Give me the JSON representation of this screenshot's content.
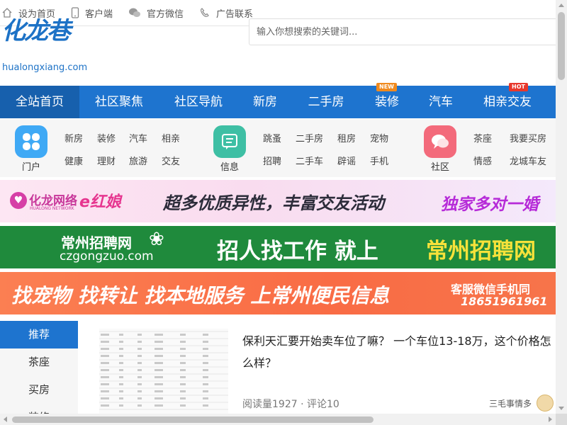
{
  "topbar": {
    "items": [
      {
        "label": "设为首页",
        "icon": "home-icon"
      },
      {
        "label": "客户端",
        "icon": "mobile-icon"
      },
      {
        "label": "官方微信",
        "icon": "wechat-icon"
      },
      {
        "label": "广告联系",
        "icon": "phone-icon"
      }
    ]
  },
  "header": {
    "logo_cn": "化龙巷",
    "logo_en": "hualongxiang.com",
    "search_placeholder": "输入你想搜索的关键词..."
  },
  "nav": {
    "items": [
      {
        "label": "全站首页"
      },
      {
        "label": "社区聚焦"
      },
      {
        "label": "社区导航"
      },
      {
        "label": "新房"
      },
      {
        "label": "二手房"
      },
      {
        "label": "装修",
        "badge": "NEW"
      },
      {
        "label": "汽车"
      },
      {
        "label": "相亲交友",
        "badge": "HOT"
      }
    ],
    "accent": "#1e74cf"
  },
  "categories": [
    {
      "label": "门户",
      "icon": "clover-icon",
      "color": "#3fa9f5",
      "links": [
        "新房",
        "装修",
        "汽车",
        "相亲",
        "健康",
        "理财",
        "旅游",
        "交友"
      ]
    },
    {
      "label": "信息",
      "icon": "message-board-icon",
      "color": "#3ebfa4",
      "links": [
        "跳蚤",
        "二手房",
        "租房",
        "宠物",
        "招聘",
        "二手车",
        "辟谣",
        "手机"
      ]
    },
    {
      "label": "社区",
      "icon": "chat-bubble-icon",
      "color": "#f36a7b",
      "links": [
        "茶座",
        "我要买房",
        "情感",
        "龙城车友"
      ]
    }
  ],
  "banners": {
    "b1": {
      "brand": "化龙网络",
      "brand_sub": "HUALONG NETWORK",
      "brand2": "e红娘",
      "slogan": "超多优质异性，丰富交友活动",
      "highlight": "独家多对一婚"
    },
    "b2": {
      "brand": "常州招聘网",
      "domain": "czgongzuo.com",
      "slogan": "招人找工作 就上",
      "highlight": "常州招聘网"
    },
    "b3": {
      "slogan": "找宠物 找转让 找本地服务 上常州便民信息",
      "contact": "客服微信手机同",
      "phone": "18651961961"
    }
  },
  "sidebar": {
    "items": [
      "推荐",
      "茶座",
      "买房",
      "装修"
    ]
  },
  "article": {
    "title": "保利天汇要开始卖车位了嘛？ 一个车位13-18万，这个价格怎么样？",
    "meta": "阅读量1927 · 评论10",
    "author": "三毛事情多"
  }
}
